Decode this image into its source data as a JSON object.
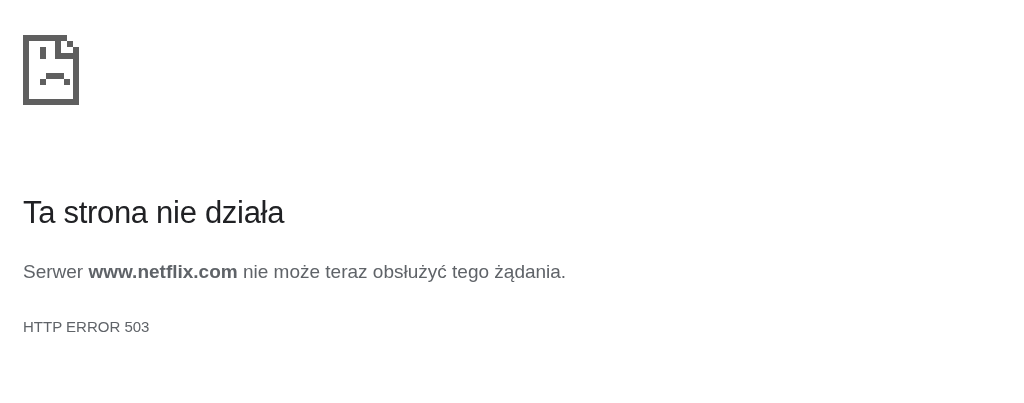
{
  "heading": "Ta strona nie działa",
  "message": "Serwer **www.netflix.com** nie może teraz obsłużyć tego żądania.",
  "error_code": "HTTP ERROR 503"
}
